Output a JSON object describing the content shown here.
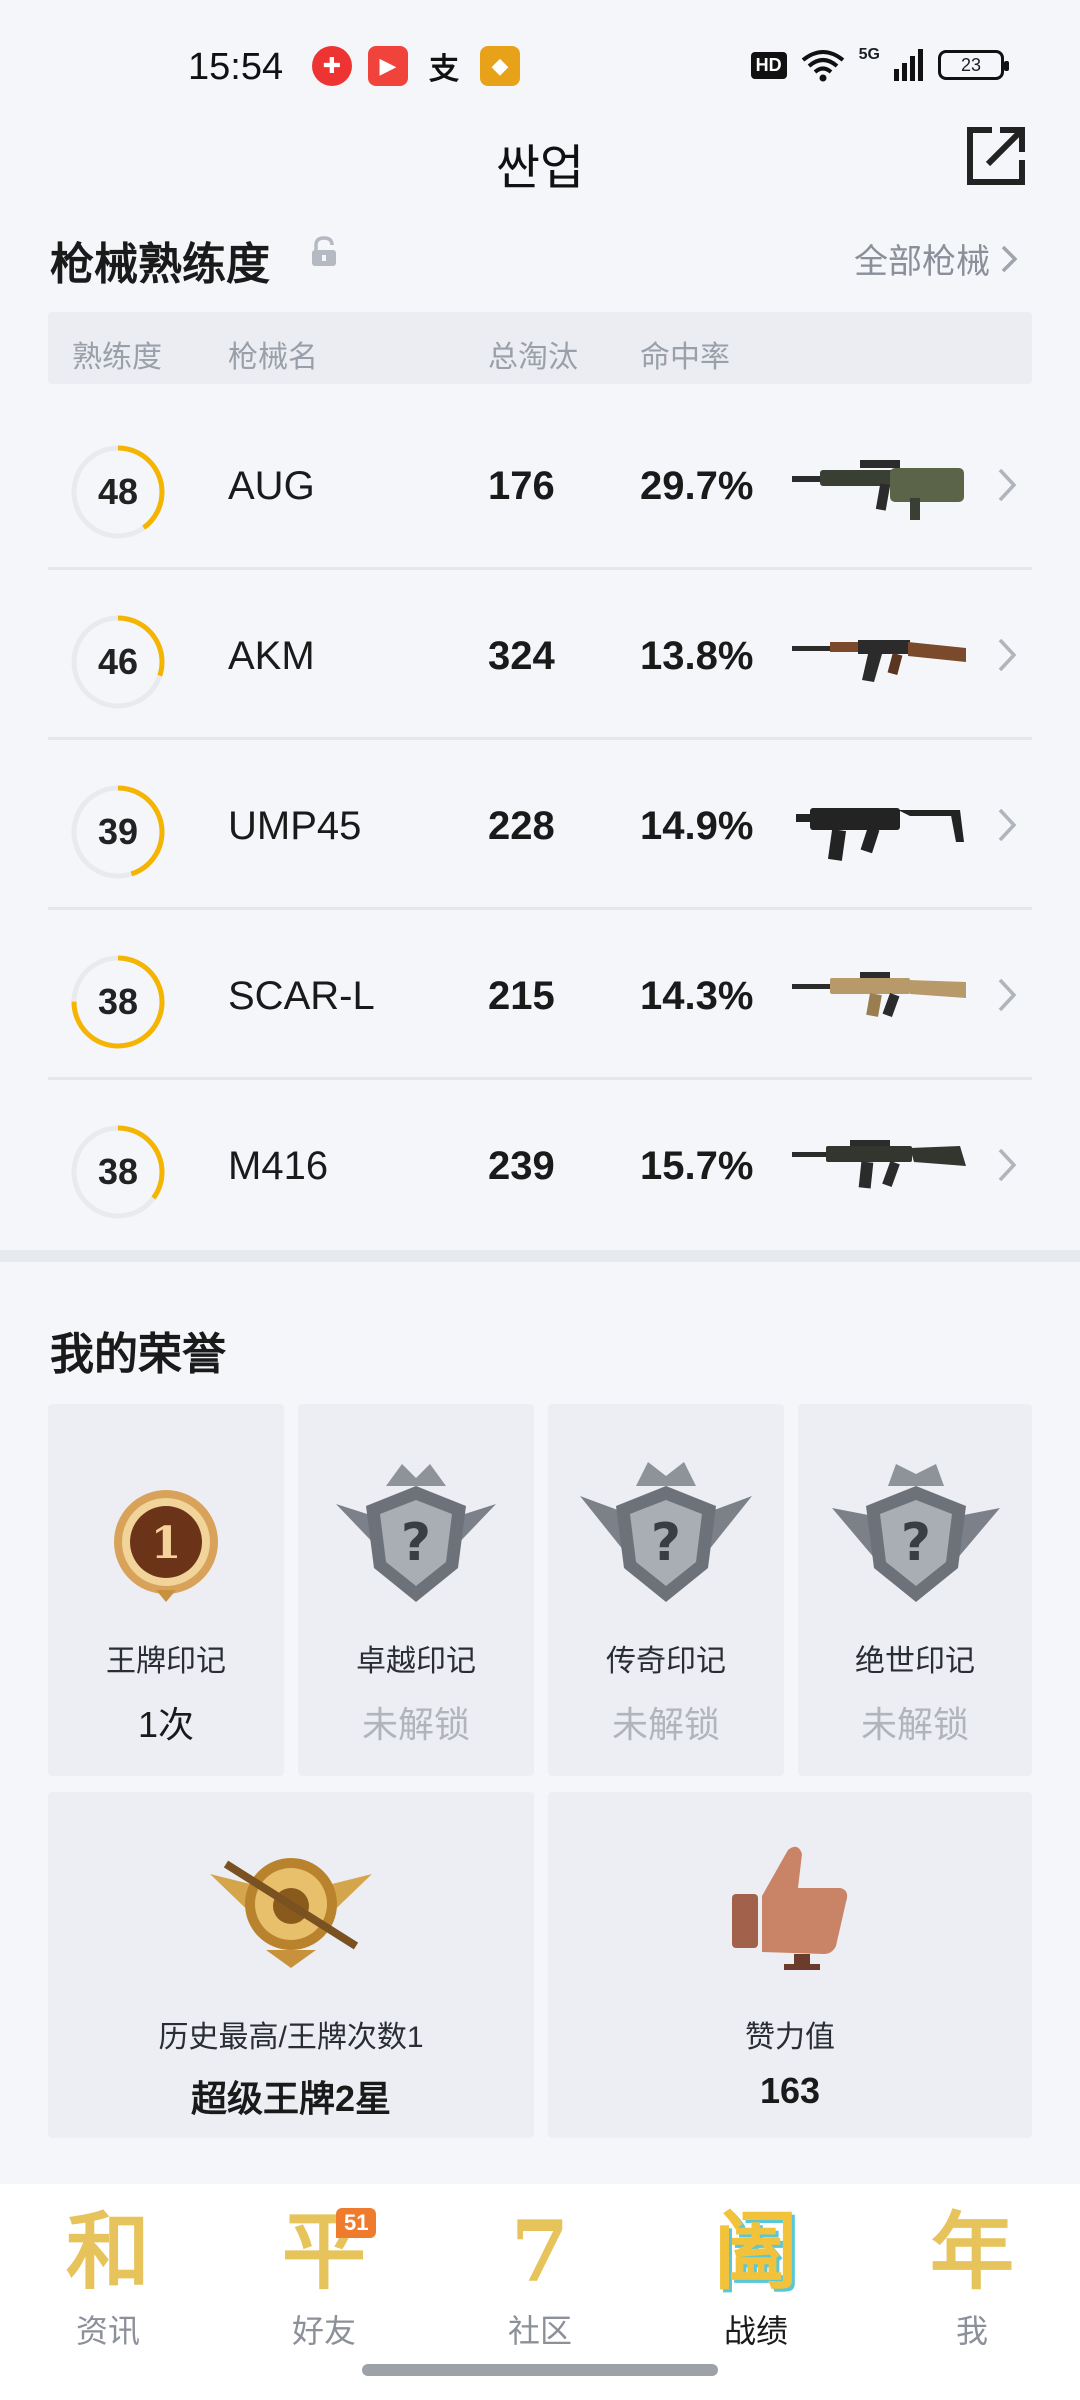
{
  "status_bar": {
    "time": "15:54",
    "hd": "HD",
    "network": "5G",
    "battery": "23"
  },
  "header": {
    "title": "싼업"
  },
  "weapons": {
    "title": "枪械熟练度",
    "all_link": "全部枪械",
    "columns": [
      "熟练度",
      "枪械名",
      "总淘汰",
      "命中率"
    ],
    "rows": [
      {
        "level": "48",
        "name": "AUG",
        "kills": "176",
        "rate": "29.7%",
        "progress": 0.4
      },
      {
        "level": "46",
        "name": "AKM",
        "kills": "324",
        "rate": "13.8%",
        "progress": 0.3
      },
      {
        "level": "39",
        "name": "UMP45",
        "kills": "228",
        "rate": "14.9%",
        "progress": 0.45
      },
      {
        "level": "38",
        "name": "SCAR-L",
        "kills": "215",
        "rate": "14.3%",
        "progress": 0.75
      },
      {
        "level": "38",
        "name": "M416",
        "kills": "239",
        "rate": "15.7%",
        "progress": 0.35
      }
    ]
  },
  "honors": {
    "title": "我的荣誉",
    "marks": [
      {
        "label": "王牌印记",
        "value": "1次"
      },
      {
        "label": "卓越印记",
        "value": "未解锁"
      },
      {
        "label": "传奇印记",
        "value": "未解锁"
      },
      {
        "label": "绝世印记",
        "value": "未解锁"
      }
    ],
    "highest": {
      "label": "历史最高/王牌次数1",
      "value": "超级王牌2星"
    },
    "likes": {
      "label": "赞力值",
      "value": "163"
    }
  },
  "nav": {
    "items": [
      {
        "glyph": "和",
        "label": "资讯"
      },
      {
        "glyph": "平",
        "label": "好友",
        "badge": "51"
      },
      {
        "glyph": "7",
        "label": "社区"
      },
      {
        "glyph": "阖",
        "label": "战绩"
      },
      {
        "glyph": "年",
        "label": "我"
      }
    ]
  },
  "colors": {
    "accent": "#f5b400",
    "ring_track": "#e8eaee",
    "nav_gold": "#e7c35b"
  }
}
